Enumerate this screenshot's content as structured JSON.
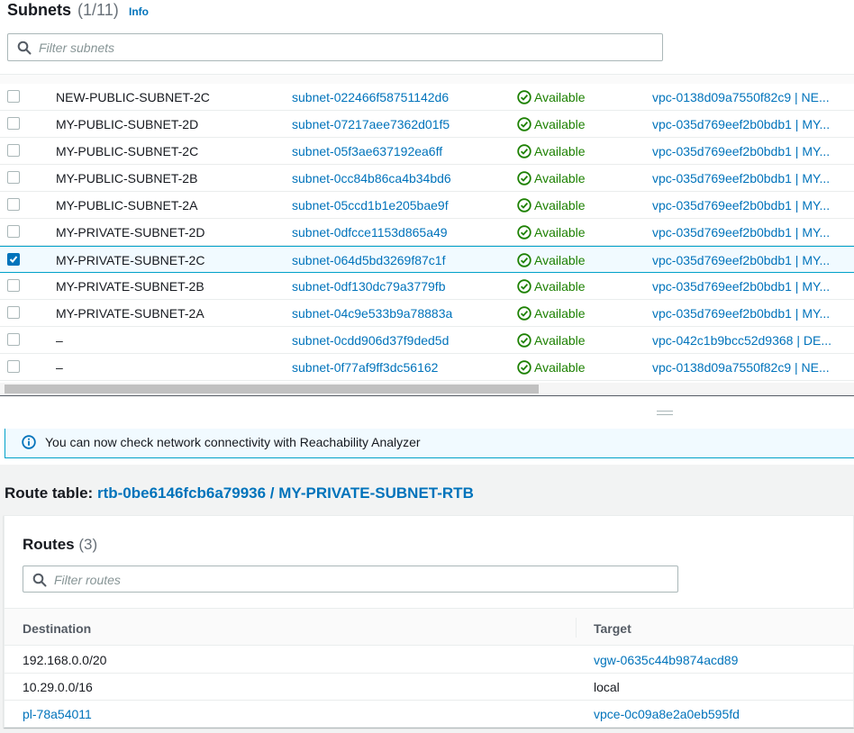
{
  "subnets": {
    "title": "Subnets",
    "count": "(1/11)",
    "info_link": "Info",
    "filter_placeholder": "Filter subnets",
    "rows": [
      {
        "name": "NEW-PUBLIC-SUBNET-2C",
        "id": "subnet-022466f58751142d6",
        "state": "Available",
        "vpc": "vpc-0138d09a7550f82c9 | NE...",
        "selected": false
      },
      {
        "name": "MY-PUBLIC-SUBNET-2D",
        "id": "subnet-07217aee7362d01f5",
        "state": "Available",
        "vpc": "vpc-035d769eef2b0bdb1 | MY...",
        "selected": false
      },
      {
        "name": "MY-PUBLIC-SUBNET-2C",
        "id": "subnet-05f3ae637192ea6ff",
        "state": "Available",
        "vpc": "vpc-035d769eef2b0bdb1 | MY...",
        "selected": false
      },
      {
        "name": "MY-PUBLIC-SUBNET-2B",
        "id": "subnet-0cc84b86ca4b34bd6",
        "state": "Available",
        "vpc": "vpc-035d769eef2b0bdb1 | MY...",
        "selected": false
      },
      {
        "name": "MY-PUBLIC-SUBNET-2A",
        "id": "subnet-05ccd1b1e205bae9f",
        "state": "Available",
        "vpc": "vpc-035d769eef2b0bdb1 | MY...",
        "selected": false
      },
      {
        "name": "MY-PRIVATE-SUBNET-2D",
        "id": "subnet-0dfcce1153d865a49",
        "state": "Available",
        "vpc": "vpc-035d769eef2b0bdb1 | MY...",
        "selected": false
      },
      {
        "name": "MY-PRIVATE-SUBNET-2C",
        "id": "subnet-064d5bd3269f87c1f",
        "state": "Available",
        "vpc": "vpc-035d769eef2b0bdb1 | MY...",
        "selected": true
      },
      {
        "name": "MY-PRIVATE-SUBNET-2B",
        "id": "subnet-0df130dc79a3779fb",
        "state": "Available",
        "vpc": "vpc-035d769eef2b0bdb1 | MY...",
        "selected": false
      },
      {
        "name": "MY-PRIVATE-SUBNET-2A",
        "id": "subnet-04c9e533b9a78883a",
        "state": "Available",
        "vpc": "vpc-035d769eef2b0bdb1 | MY...",
        "selected": false
      },
      {
        "name": "–",
        "id": "subnet-0cdd906d37f9ded5d",
        "state": "Available",
        "vpc": "vpc-042c1b9bcc52d9368 | DE...",
        "selected": false
      },
      {
        "name": "–",
        "id": "subnet-0f77af9ff3dc56162",
        "state": "Available",
        "vpc": "vpc-0138d09a7550f82c9 | NE...",
        "selected": false
      }
    ]
  },
  "banner": {
    "text": "You can now check network connectivity with Reachability Analyzer"
  },
  "route_table": {
    "label": "Route table:",
    "link": "rtb-0be6146fcb6a79936 / MY-PRIVATE-SUBNET-RTB"
  },
  "routes": {
    "title": "Routes",
    "count": "(3)",
    "filter_placeholder": "Filter routes",
    "columns": {
      "destination": "Destination",
      "target": "Target"
    },
    "rows": [
      {
        "destination": "192.168.0.0/20",
        "dest_link": false,
        "target": "vgw-0635c44b9874acd89",
        "target_link": true
      },
      {
        "destination": "10.29.0.0/16",
        "dest_link": false,
        "target": "local",
        "target_link": false
      },
      {
        "destination": "pl-78a54011",
        "dest_link": true,
        "target": "vpce-0c09a8e2a0eb595fd",
        "target_link": true
      }
    ]
  },
  "colors": {
    "link": "#0073bb",
    "available": "#1d8102",
    "selected_row": "#f1faff",
    "selected_border": "#00a1c9"
  },
  "icons": {
    "search": "search-icon",
    "status": "check-circle-icon",
    "info": "info-circle-icon",
    "checkbox_checked": "checkmark-icon"
  }
}
